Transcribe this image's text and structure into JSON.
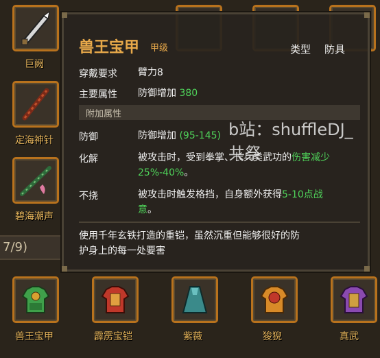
{
  "left_column": [
    {
      "label": "巨阙"
    },
    {
      "label": "定海神针"
    },
    {
      "label": "碧海潮声"
    }
  ],
  "counter": {
    "text": "7/9)"
  },
  "bottom_items": [
    {
      "label": "兽王宝甲"
    },
    {
      "label": "霹雳宝铠"
    },
    {
      "label": "紫薇"
    },
    {
      "label": "狻猊"
    },
    {
      "label": "真武"
    }
  ],
  "tooltip": {
    "title": "兽王宝甲",
    "grade": "甲级",
    "type_key": "类型",
    "type_value": "防具",
    "requirement_key": "穿戴要求",
    "requirement_value": "臂力8",
    "main_attr_key": "主要属性",
    "main_attr_label": "防御增加",
    "main_attr_value": "380",
    "extra_attr_band": "附加属性",
    "defense_key": "防御",
    "defense_label": "防御增加",
    "defense_range": "(95-145)",
    "resolve_key": "化解",
    "resolve_text_1": "被攻击时，受到拳掌、长兵类武功的",
    "resolve_green_1": "伤害减少",
    "resolve_green_2": "25%-40%",
    "resolve_end": "。",
    "unyield_key": "不挠",
    "unyield_text_1": "被攻击时触发格挡，自身额外获得",
    "unyield_green": "5-10点战",
    "unyield_green_2": "意",
    "unyield_end": "。",
    "description_1": "使用千年玄铁打造的重铠，虽然沉重但能够很好的防",
    "description_2": "护身上的每一处要害",
    "watermark": "b站：shuffleDJ_共祭"
  },
  "colors": {
    "accent": "#b8721d",
    "title": "#e8a94a",
    "green": "#4fd35a"
  }
}
